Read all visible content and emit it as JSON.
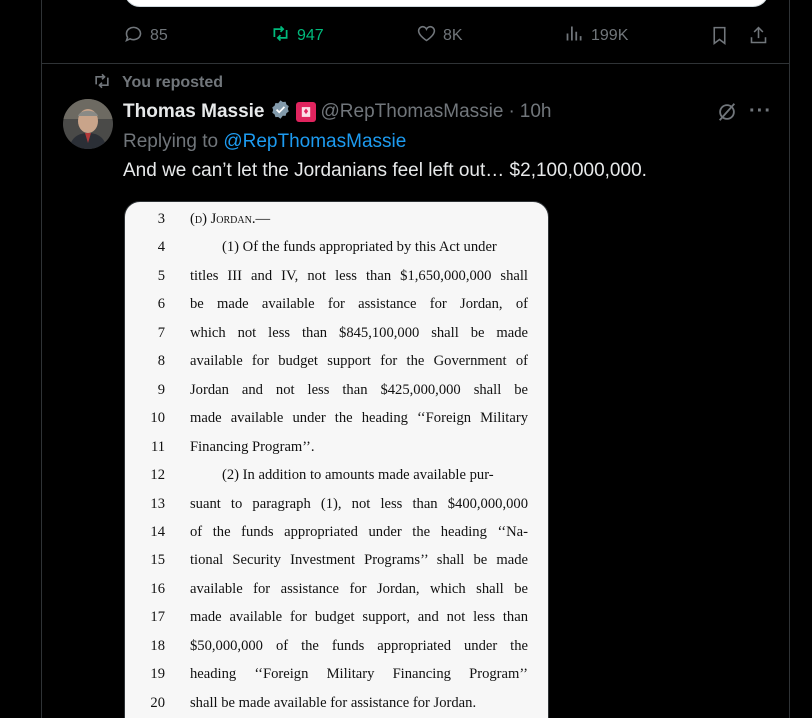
{
  "previous_tweet": {
    "actions": {
      "replies": "85",
      "reposts": "947",
      "likes": "8K",
      "views": "199K"
    }
  },
  "repost_banner": {
    "label": "You reposted"
  },
  "tweet": {
    "display_name": "Thomas Massie",
    "handle": "@RepThomasMassie",
    "separator": "·",
    "time": "10h",
    "reply_prefix": "Replying to",
    "reply_mention": "@RepThomasMassie",
    "text": "And we can’t let the Jordanians feel left out… $2,100,000,000.",
    "colors": {
      "accent": "#1d9bf0",
      "retweet_green": "#00ba7c",
      "verified": "#829aab",
      "affiliate_badge": "#e0245e"
    }
  },
  "document": {
    "lines": [
      {
        "n": "3",
        "text": "(d) Jordan.—"
      },
      {
        "n": "4",
        "text": "(1) Of the funds appropriated by this Act under"
      },
      {
        "n": "5",
        "text": "titles III and IV, not less than $1,650,000,000 shall"
      },
      {
        "n": "6",
        "text": "be made available for assistance for Jordan, of"
      },
      {
        "n": "7",
        "text": "which not less than $845,100,000 shall be made"
      },
      {
        "n": "8",
        "text": "available for budget support for the Government of"
      },
      {
        "n": "9",
        "text": "Jordan and not less than $425,000,000 shall be"
      },
      {
        "n": "10",
        "text": "made available under the heading ‘‘Foreign Military"
      },
      {
        "n": "11",
        "text": "Financing Program’’."
      },
      {
        "n": "12",
        "text": "(2) In addition to amounts made available pur-"
      },
      {
        "n": "13",
        "text": "suant to paragraph (1), not less than $400,000,000"
      },
      {
        "n": "14",
        "text": "of the funds appropriated under the heading ‘‘Na-"
      },
      {
        "n": "15",
        "text": "tional Security Investment Programs’’ shall be made"
      },
      {
        "n": "16",
        "text": "available for assistance for Jordan, which shall be"
      },
      {
        "n": "17",
        "text": "made available for budget support, and not less than"
      },
      {
        "n": "18",
        "text": "$50,000,000 of the funds appropriated under the"
      },
      {
        "n": "19",
        "text": "heading ‘‘Foreign Military Financing Program’’"
      },
      {
        "n": "20",
        "text": "shall be made available for assistance for Jordan."
      }
    ]
  }
}
